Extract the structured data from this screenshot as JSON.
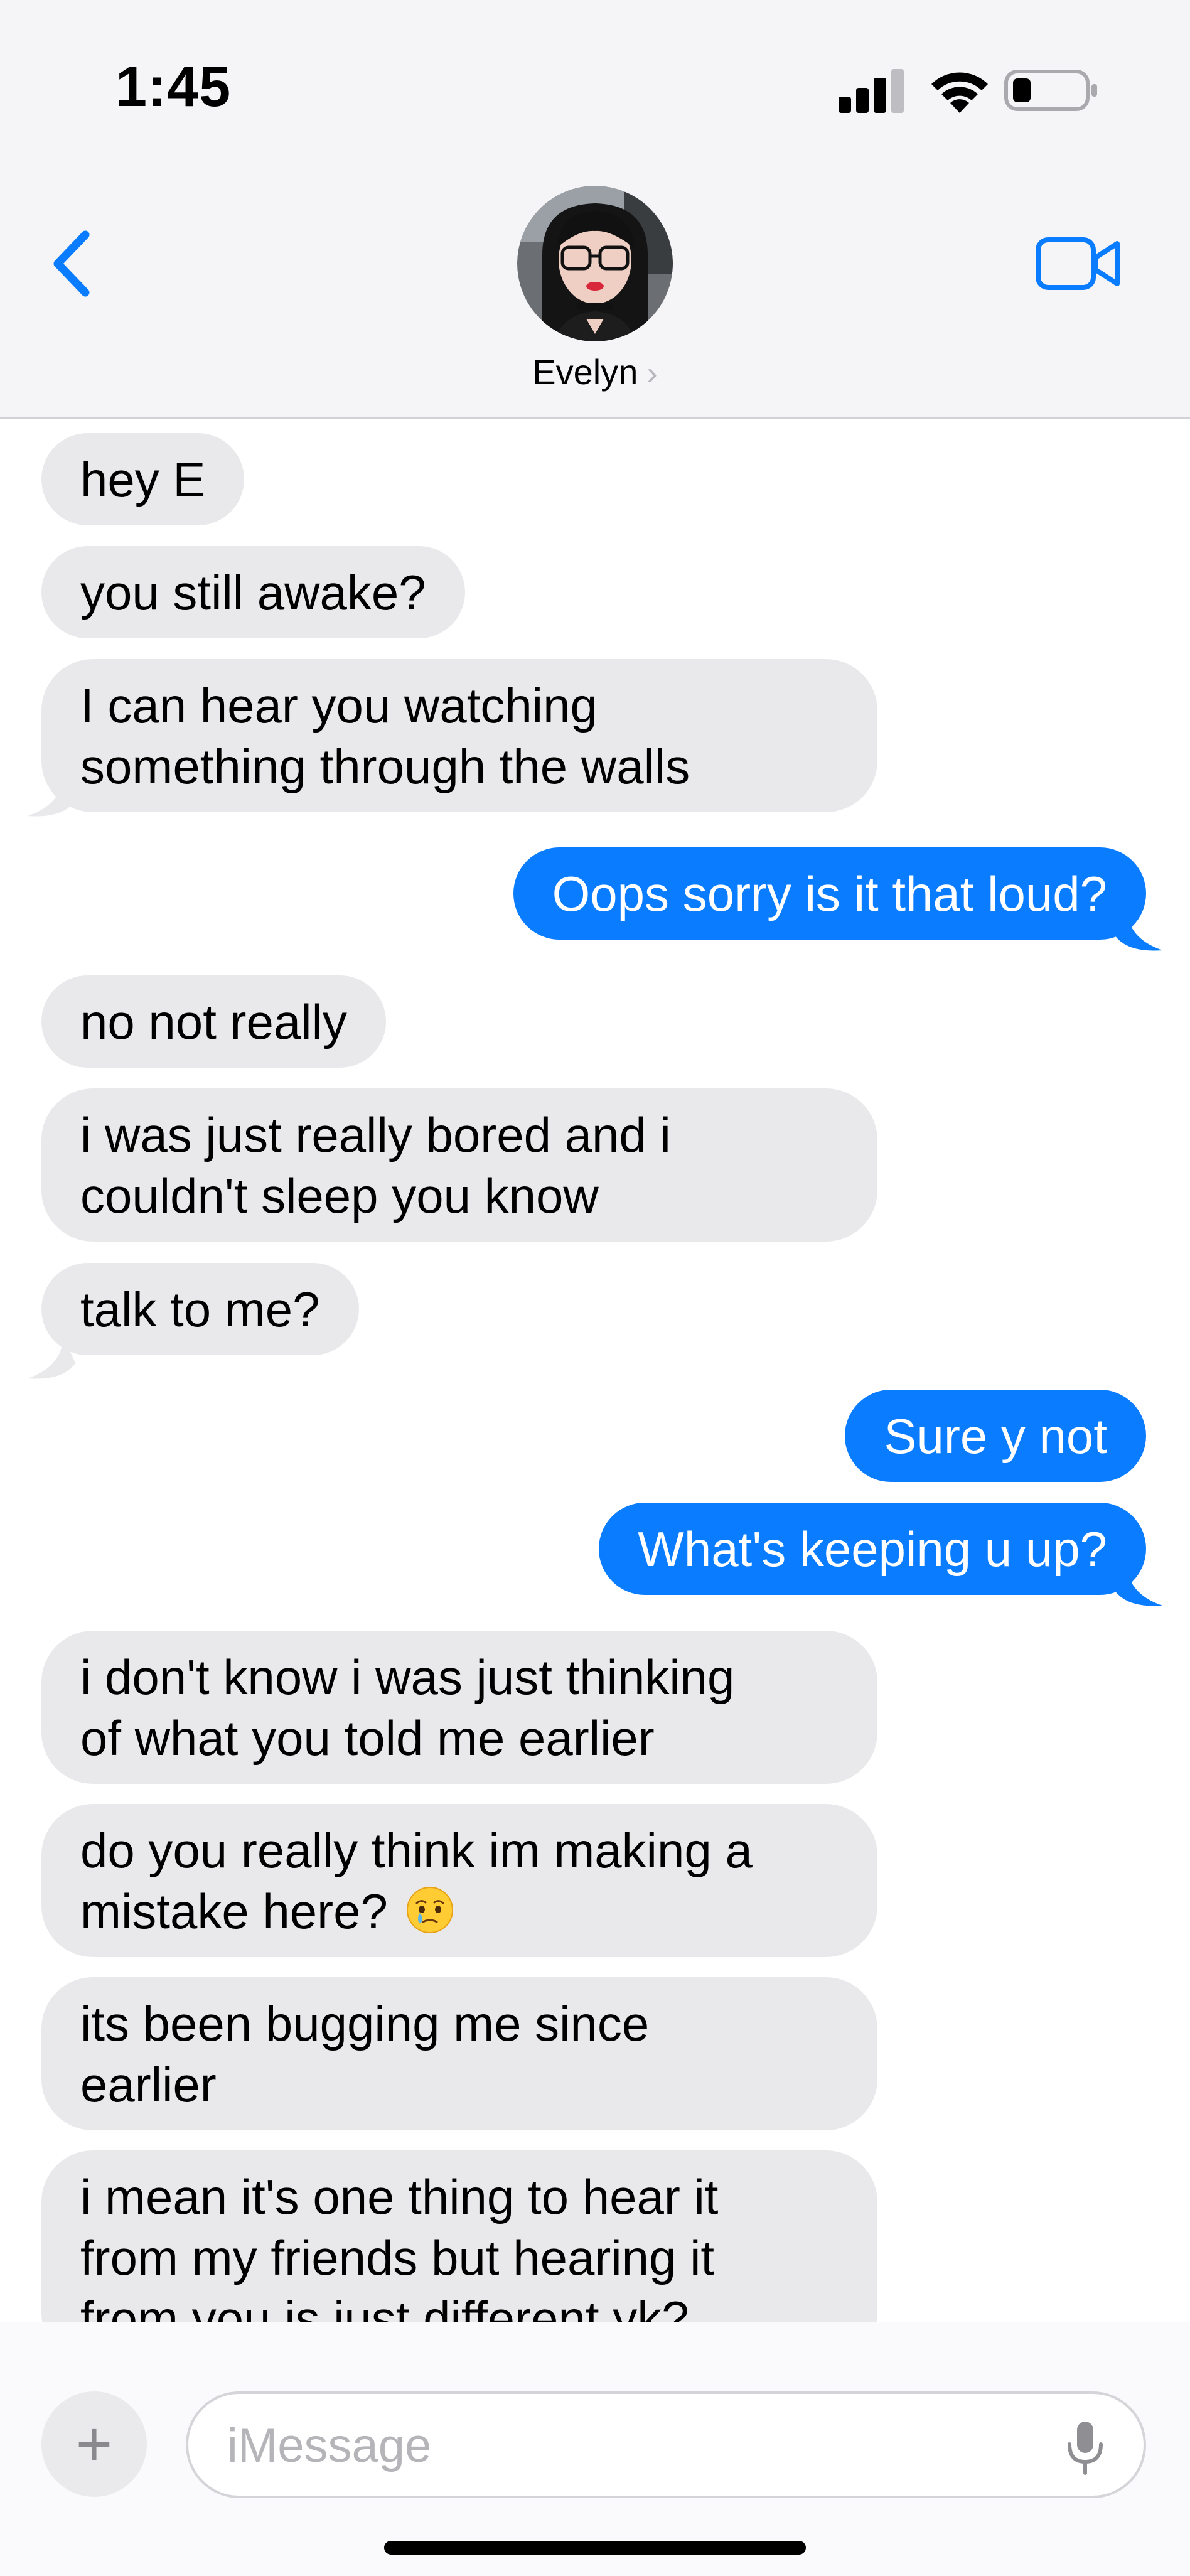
{
  "status_bar": {
    "time": "1:45"
  },
  "header": {
    "contact_name": "Evelyn",
    "chevron": "›"
  },
  "icons": {
    "back": "chevron-left-icon",
    "video": "video-camera-icon",
    "mic": "microphone-icon",
    "plus": "plus-icon"
  },
  "colors": {
    "incoming_bubble": "#e9e9eb",
    "outgoing_bubble": "#0a7cff",
    "accent": "#0a7cff"
  },
  "messages": [
    {
      "from": "contact",
      "lines": [
        "hey E"
      ]
    },
    {
      "from": "contact",
      "lines": [
        "you still awake?"
      ]
    },
    {
      "from": "contact",
      "lines": [
        "I can hear you watching",
        "something through the walls"
      ]
    },
    {
      "from": "me",
      "lines": [
        "Oops sorry is it that loud?"
      ]
    },
    {
      "from": "contact",
      "lines": [
        "no not really"
      ]
    },
    {
      "from": "contact",
      "lines": [
        "i was just really bored and i",
        "couldn't sleep you know"
      ]
    },
    {
      "from": "contact",
      "lines": [
        "talk to me?"
      ]
    },
    {
      "from": "me",
      "lines": [
        "Sure y not"
      ]
    },
    {
      "from": "me",
      "lines": [
        "What's keeping u up?"
      ]
    },
    {
      "from": "contact",
      "lines": [
        "i don't know i was just thinking",
        "of what you told me earlier"
      ]
    },
    {
      "from": "contact",
      "lines": [
        "do you really think im making a",
        "mistake here?"
      ],
      "emoji": "face-holding-back-tears-emoji"
    },
    {
      "from": "contact",
      "lines": [
        "its been bugging me since",
        "earlier"
      ]
    },
    {
      "from": "contact",
      "lines": [
        "i mean it's one thing to hear it",
        "from my friends but hearing it",
        "from you is just different yk?"
      ]
    }
  ],
  "composer": {
    "plus_label": "+",
    "placeholder": "iMessage"
  }
}
